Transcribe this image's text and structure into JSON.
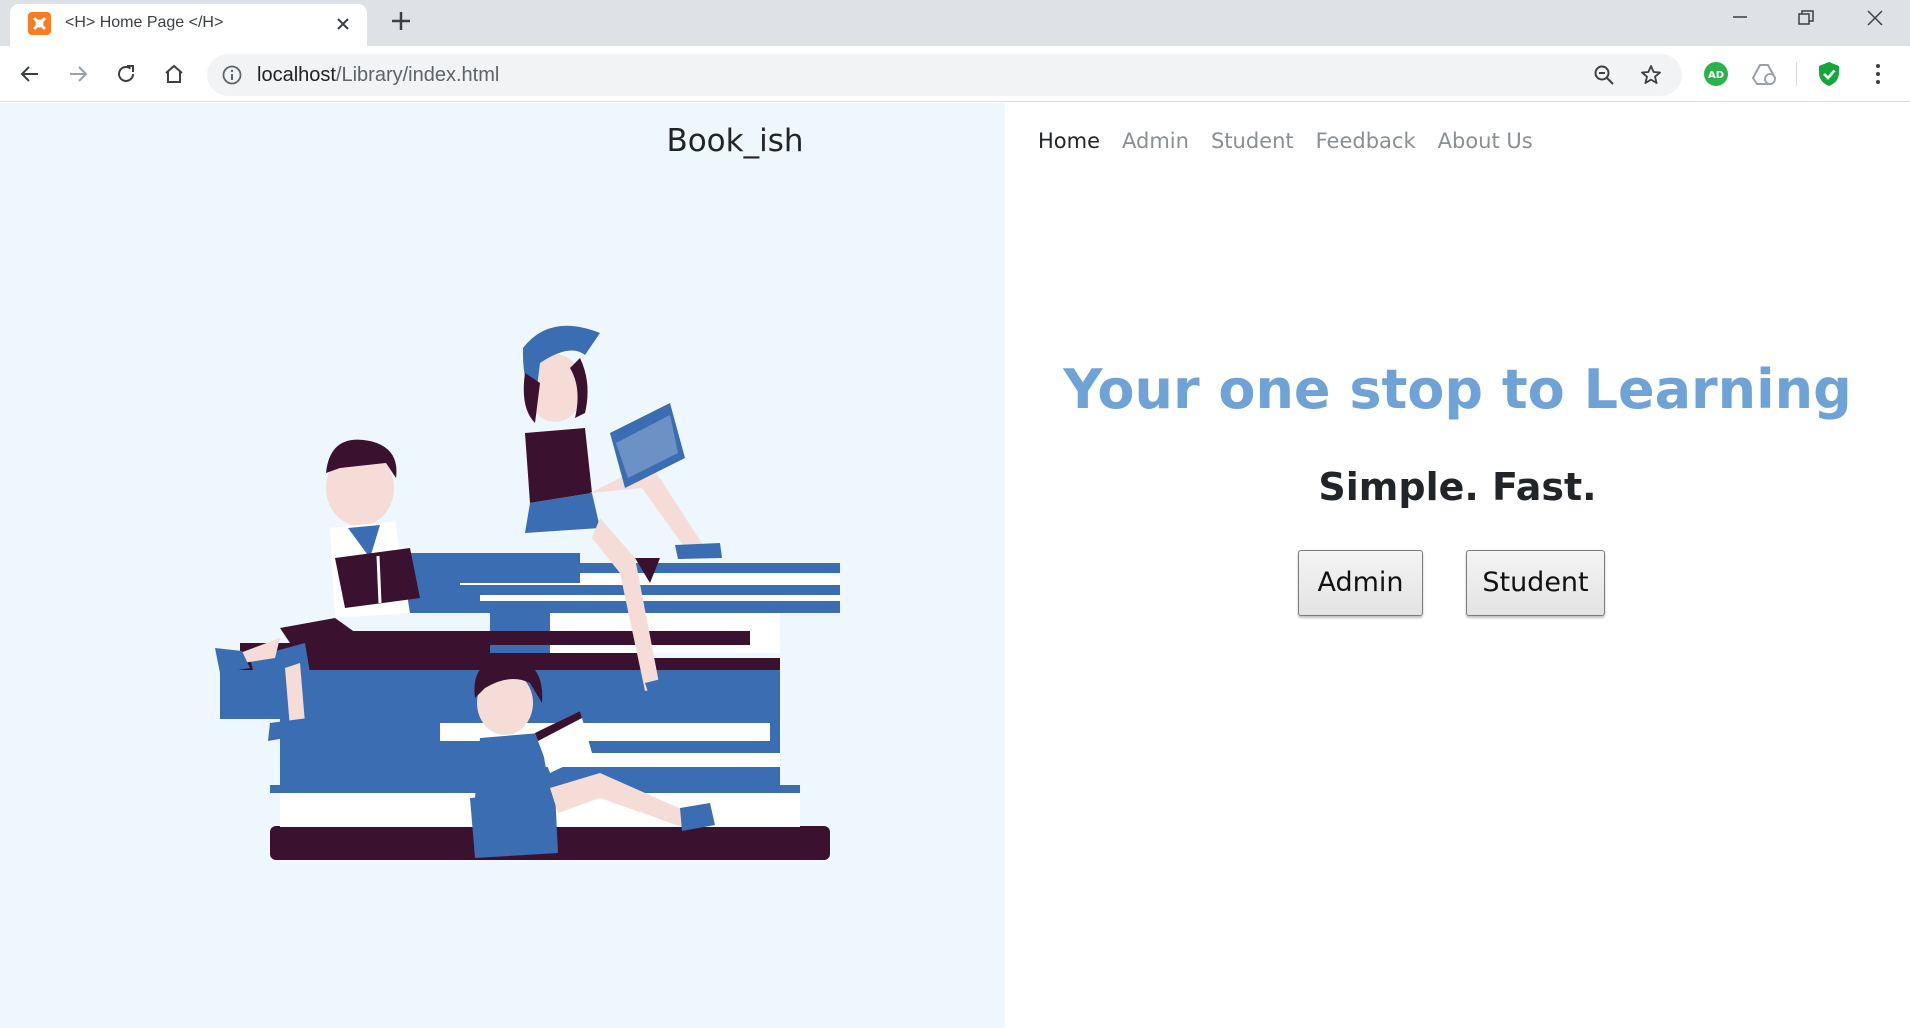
{
  "browser": {
    "tab_title": "<H> Home Page </H>",
    "url_host": "localhost",
    "url_path": "/Library/index.html",
    "extensions": [
      "adguard-icon",
      "drive-sync-icon",
      "shield-check-icon"
    ]
  },
  "page": {
    "brand": "Book_ish",
    "nav": {
      "home": "Home",
      "admin": "Admin",
      "student": "Student",
      "feedback": "Feedback",
      "about": "About Us"
    },
    "hero": {
      "title": "Your one stop to Learning",
      "subtitle": "Simple. Fast."
    },
    "buttons": {
      "admin": "Admin",
      "student": "Student"
    },
    "colors": {
      "left_pane_bg": "#eff7fe",
      "hero_title": "#6fa2d6",
      "illustration_blue": "#3b6db2",
      "illustration_dark": "#3a1230"
    }
  }
}
